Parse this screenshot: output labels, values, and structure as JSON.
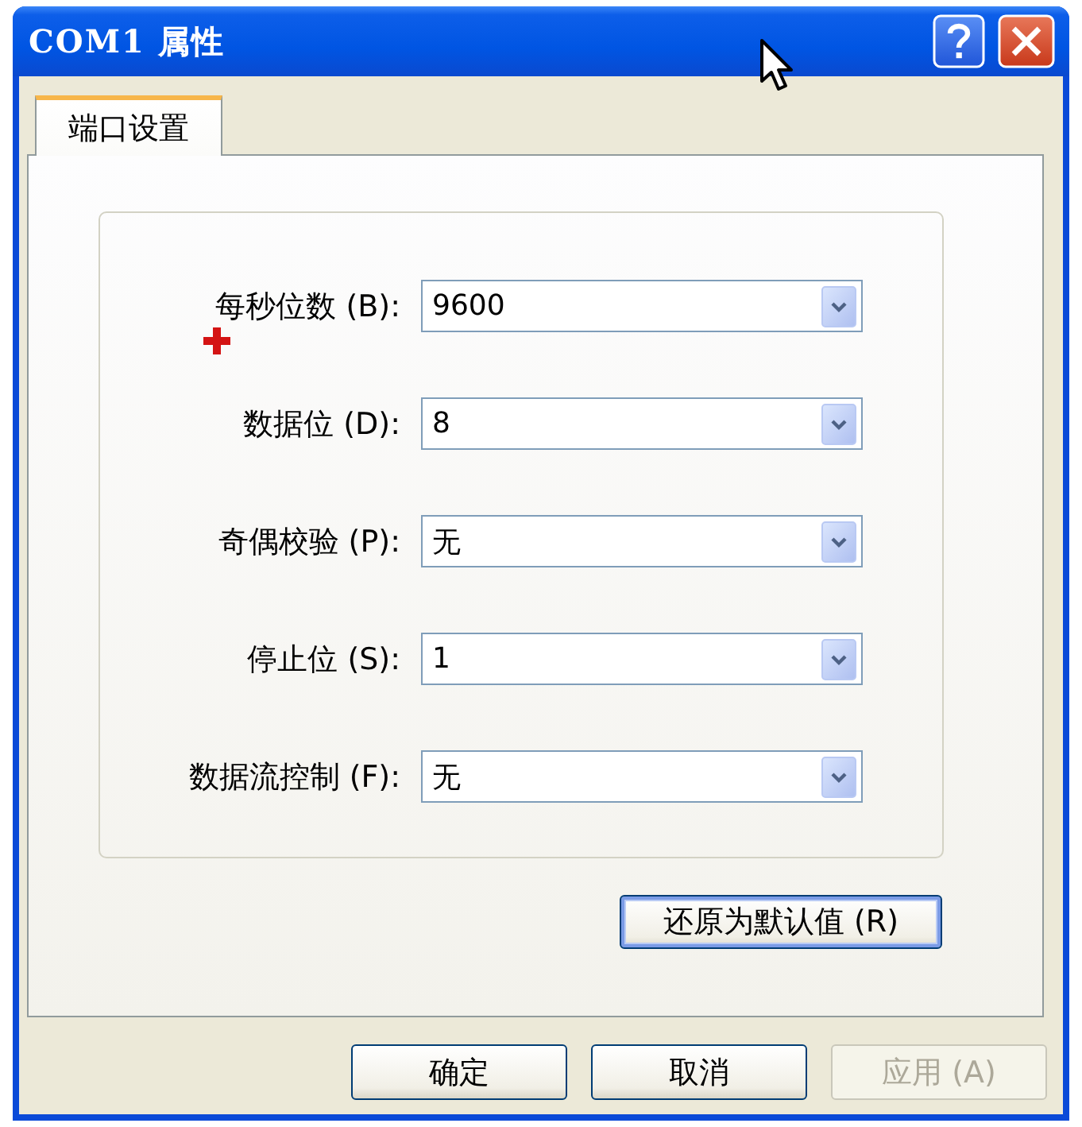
{
  "window": {
    "title": "COM1 属性"
  },
  "tabs": [
    {
      "label": "端口设置",
      "selected": true
    }
  ],
  "settings": [
    {
      "label": "每秒位数 (B):",
      "value": "9600"
    },
    {
      "label": "数据位 (D):",
      "value": "8"
    },
    {
      "label": "奇偶校验 (P):",
      "value": "无"
    },
    {
      "label": "停止位 (S):",
      "value": "1"
    },
    {
      "label": "数据流控制 (F):",
      "value": "无"
    }
  ],
  "restore_button": {
    "label": "还原为默认值 (R)",
    "focused": true
  },
  "buttons": [
    {
      "label": "确定",
      "disabled": false
    },
    {
      "label": "取消",
      "disabled": false
    },
    {
      "label": "应用 (A)",
      "disabled": true
    }
  ]
}
